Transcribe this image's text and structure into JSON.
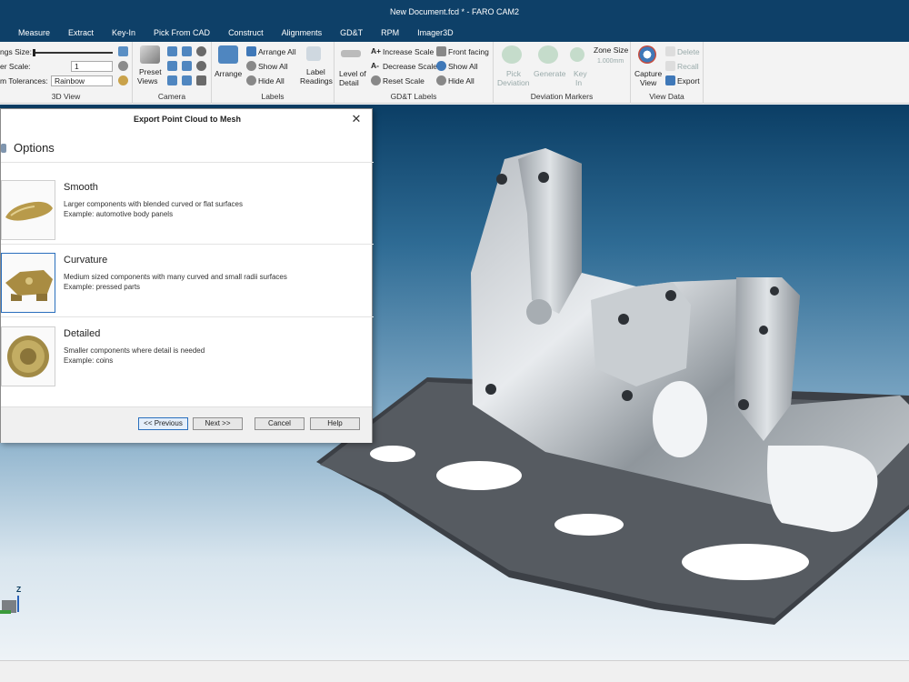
{
  "window": {
    "title": "New Document.fcd * - FARO CAM2"
  },
  "menu": [
    "Measure",
    "Extract",
    "Key-In",
    "Pick From CAD",
    "Construct",
    "Alignments",
    "GD&T",
    "RPM",
    "Imager3D"
  ],
  "ribbon": {
    "view3d": {
      "label": "3D View",
      "settings_label": "ngs Size:",
      "scale_label": "er Scale:",
      "scale_value": "1",
      "tolerance_label": "m Tolerances:",
      "tolerance_value": "Rainbow"
    },
    "camera": {
      "label": "Camera",
      "preset_line1": "Preset",
      "preset_line2": "Views"
    },
    "labels": {
      "label": "Labels",
      "arrange": "Arrange",
      "arrange_all": "Arrange All",
      "show_all": "Show All",
      "hide_all": "Hide All",
      "readings_line1": "Label",
      "readings_line2": "Readings"
    },
    "gdt_labels": {
      "label": "GD&T Labels",
      "lod_line1": "Level of",
      "lod_line2": "Detail",
      "increase_scale": "Increase Scale",
      "decrease_scale": "Decrease Scale",
      "reset_scale": "Reset Scale",
      "front_facing": "Front facing",
      "show_all": "Show All",
      "hide_all": "Hide All"
    },
    "deviation": {
      "label": "Deviation Markers",
      "pick_line1": "Pick",
      "pick_line2": "Deviation",
      "generate": "Generate",
      "key_line1": "Key",
      "key_line2": "In",
      "zone_size": "Zone Size",
      "zone_value": "1.000mm"
    },
    "view_data": {
      "label": "View Data",
      "capture_line1": "Capture",
      "capture_line2": "View",
      "delete": "Delete",
      "recall": "Recall",
      "export": "Export"
    }
  },
  "dialog": {
    "title": "Export Point Cloud to Mesh",
    "close": "✕",
    "header": "Options",
    "options": [
      {
        "title": "Smooth",
        "desc": "Larger components with blended curved or flat surfaces",
        "example": "Example: automotive body panels"
      },
      {
        "title": "Curvature",
        "desc": "Medium sized components with many curved and small radii surfaces",
        "example": "Example: pressed parts"
      },
      {
        "title": "Detailed",
        "desc": "Smaller components where detail is needed",
        "example": "Example: coins"
      }
    ],
    "buttons": {
      "previous": "<< Previous",
      "next": "Next >>",
      "cancel": "Cancel",
      "help": "Help"
    }
  },
  "axis": {
    "z": "Z"
  },
  "colors": {
    "titlebar": "#0e4068",
    "viewport_top": "#0b3e65",
    "viewport_bottom": "#eef3f7",
    "accent": "#2a6fbd"
  }
}
